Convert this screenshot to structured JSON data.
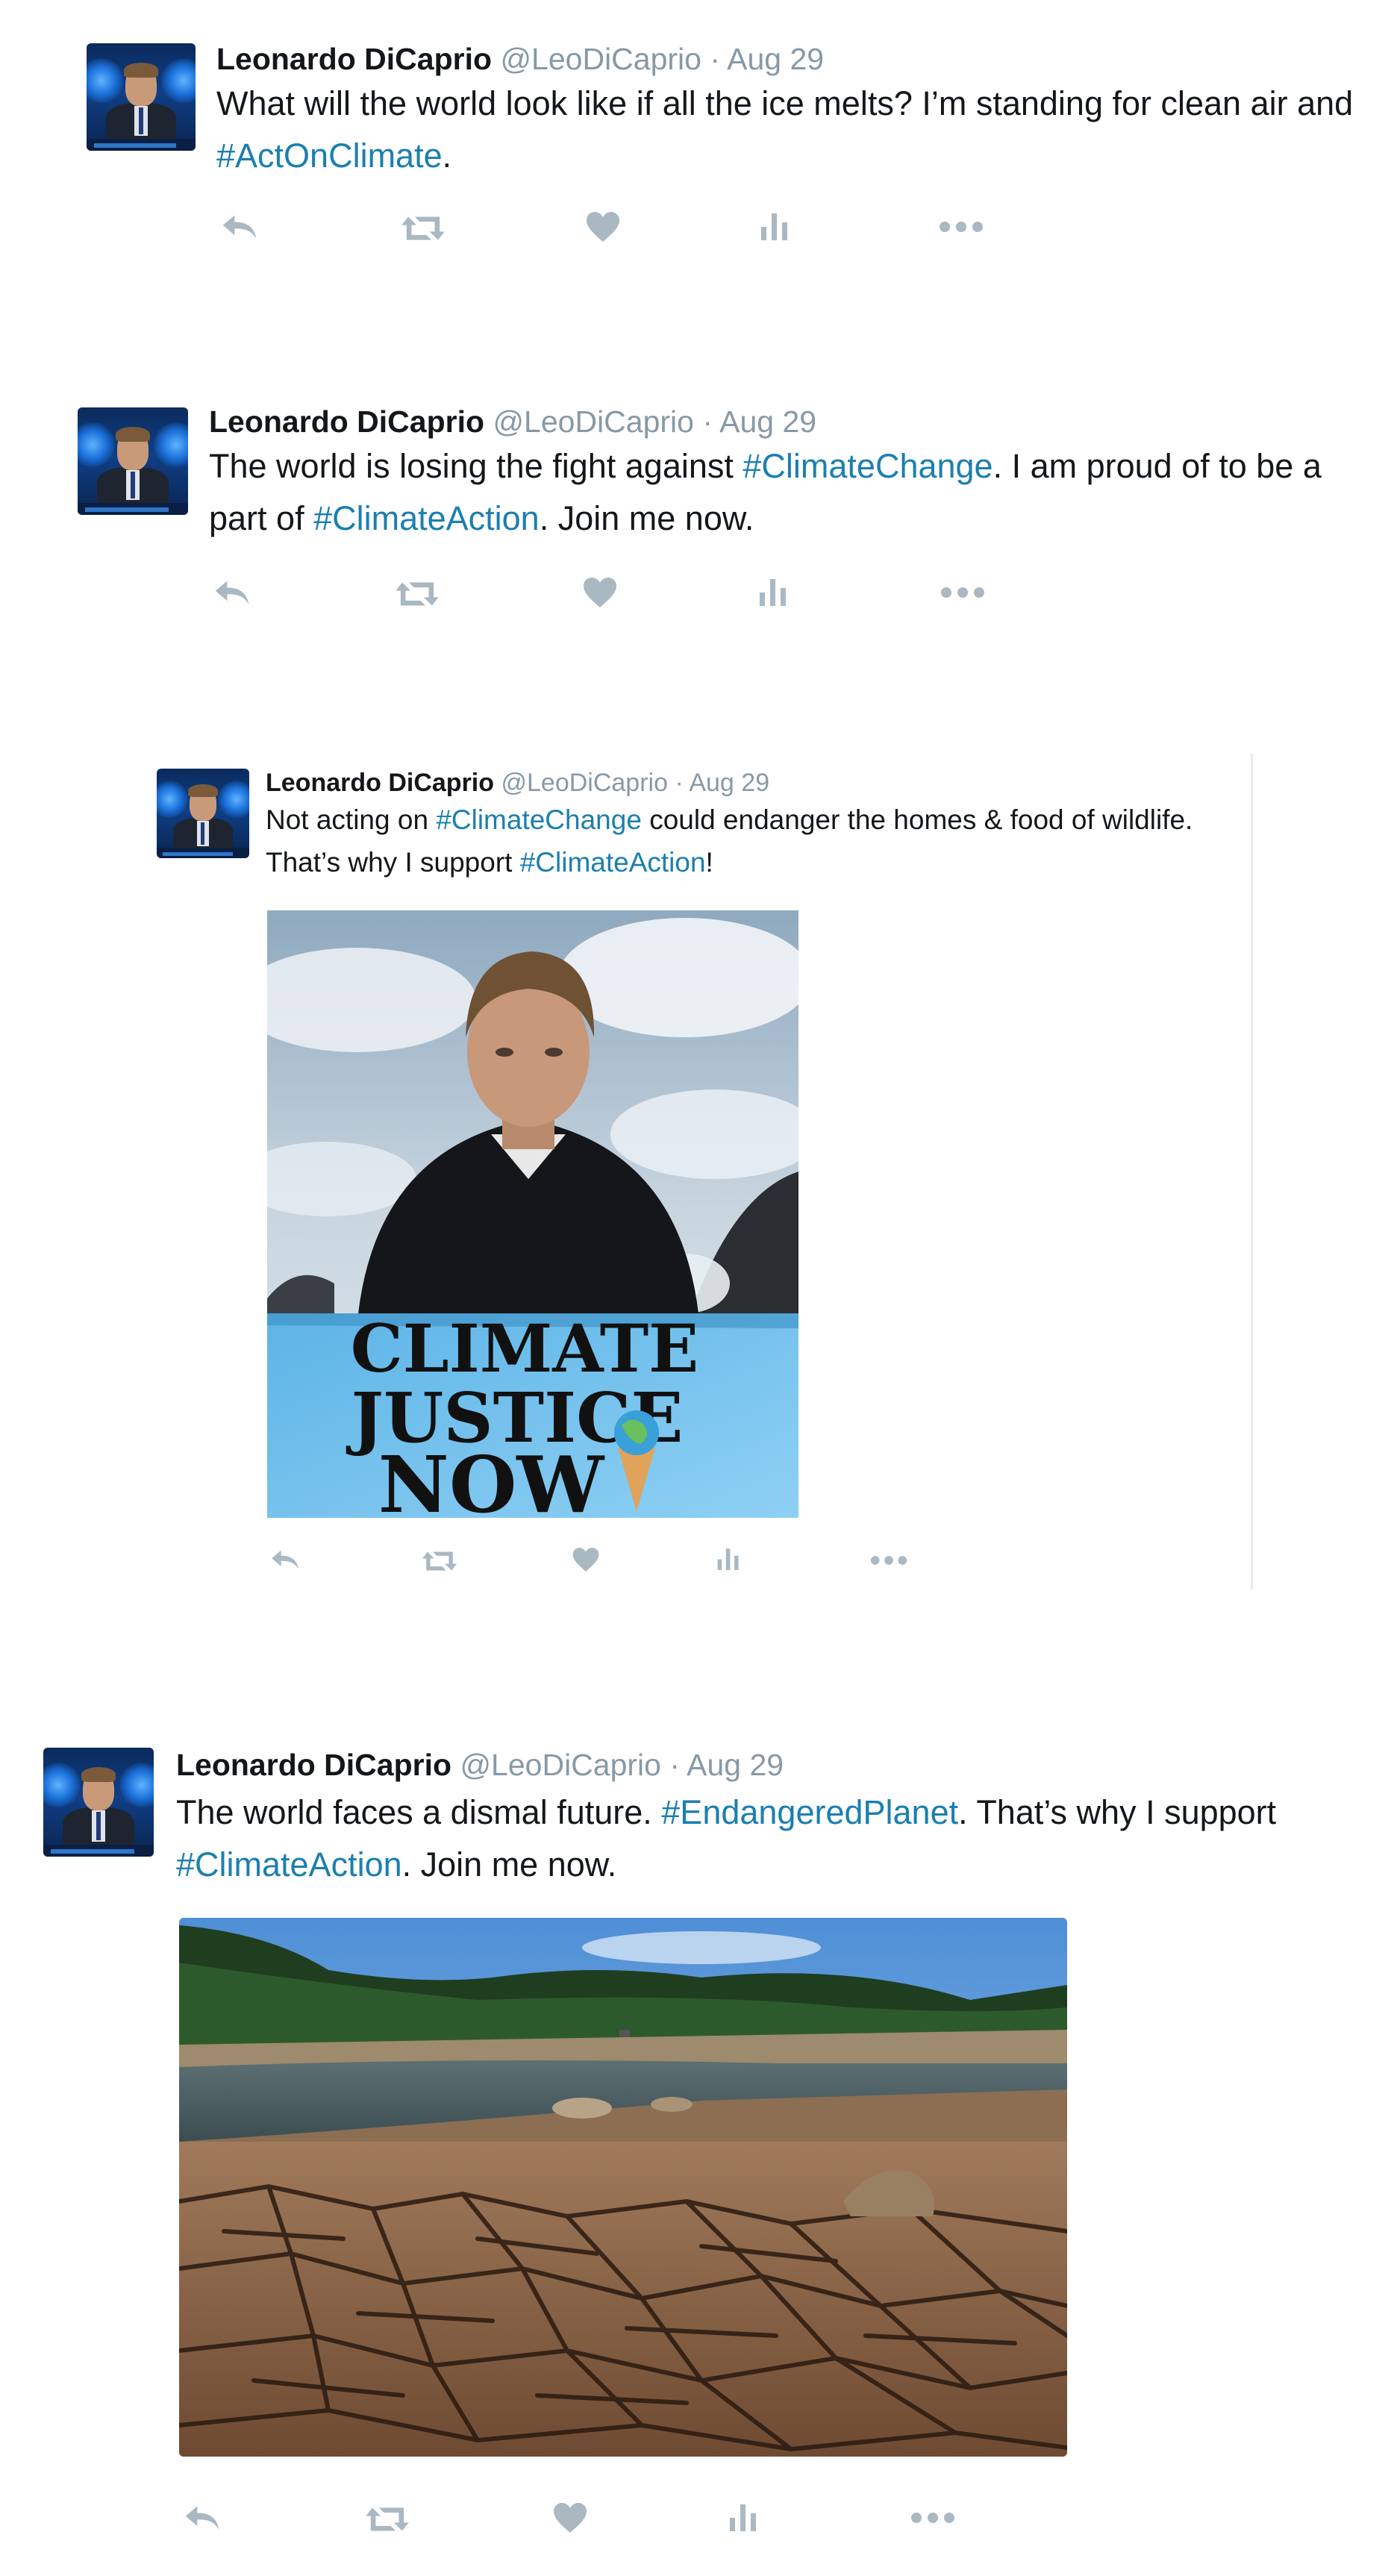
{
  "tweets": [
    {
      "author_name": "Leonardo DiCaprio",
      "author_handle": "@LeoDiCaprio",
      "date": "· Aug 29",
      "text_parts": [
        "What will the world look like if all the ice melts? I’m standing for clean air and ",
        "#ActOnClimate",
        "."
      ]
    },
    {
      "author_name": "Leonardo DiCaprio",
      "author_handle": "@LeoDiCaprio",
      "date": "· Aug 29",
      "text_parts": [
        "The world is losing the fight against ",
        "#ClimateChange",
        ". I am proud of to be a part of ",
        "#ClimateAction",
        ". Join me now."
      ]
    },
    {
      "author_name": "Leonardo DiCaprio",
      "author_handle": "@LeoDiCaprio",
      "date": "· Aug 29",
      "text_parts": [
        "Not acting on ",
        "#ClimateChange",
        " could endanger the homes & food of wildlife. That’s why I support ",
        "#ClimateAction",
        "!"
      ],
      "image_banner_lines": [
        "CLIMATE",
        "JUSTICE",
        "NOW"
      ]
    },
    {
      "author_name": "Leonardo DiCaprio",
      "author_handle": "@LeoDiCaprio",
      "date": "· Aug 29",
      "text_parts": [
        "The world faces a dismal future. ",
        "#EndangeredPlanet",
        ". That’s why I support ",
        "#ClimateAction",
        ". Join me now."
      ]
    }
  ],
  "actions": [
    "reply-icon",
    "retweet-icon",
    "like-icon",
    "analytics-icon",
    "more-icon"
  ],
  "colors": {
    "hashtag": "#1b7fb0",
    "muted": "#8899a6",
    "icon": "#aab8c2",
    "text": "#14171a"
  }
}
